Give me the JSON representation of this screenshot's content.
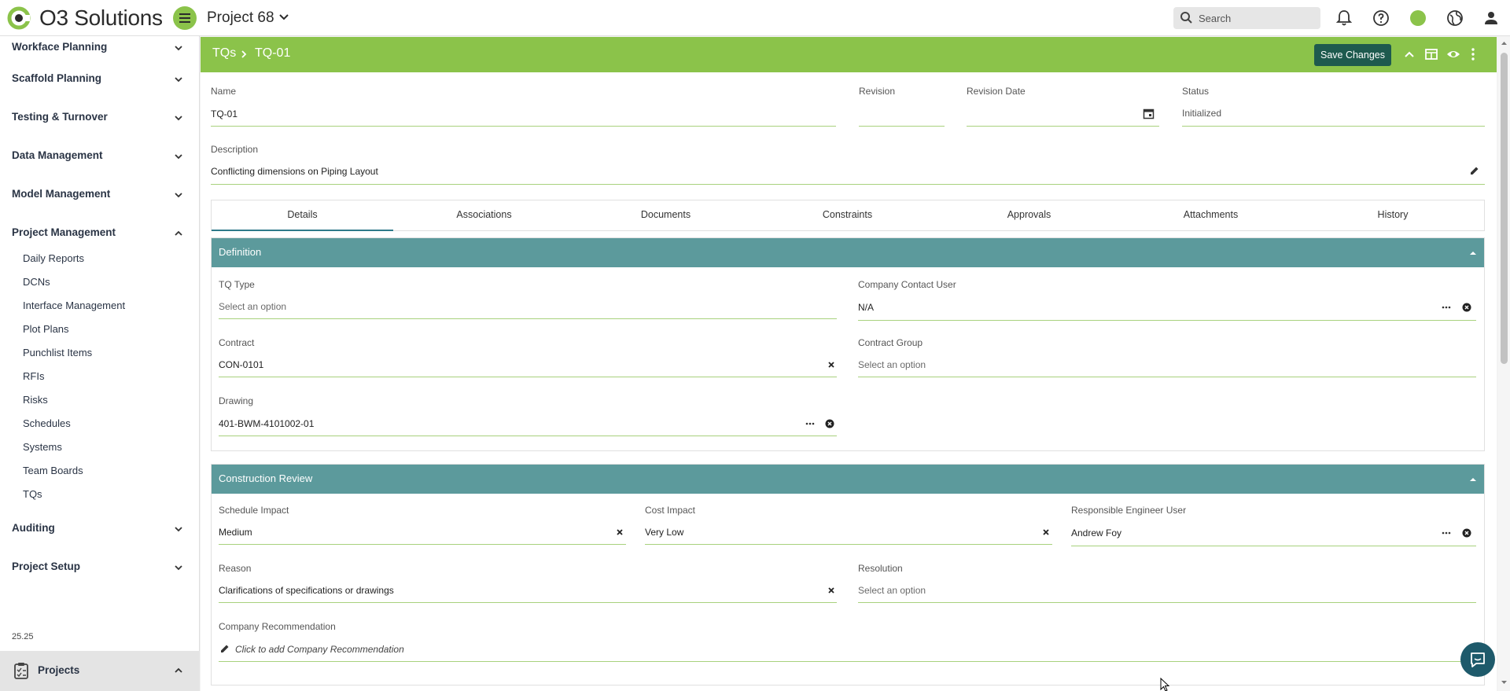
{
  "app": {
    "logo_text": "O3 Solutions",
    "project_title": "Project 68",
    "search_placeholder": "Search",
    "version": "25.25",
    "accent_color": "#8bc34a",
    "header_color": "#5c9a9c"
  },
  "sidebar": {
    "sections_top": [
      {
        "label": "Workface Planning",
        "expanded": false
      },
      {
        "label": "Scaffold Planning",
        "expanded": false
      },
      {
        "label": "Testing & Turnover",
        "expanded": false
      },
      {
        "label": "Data Management",
        "expanded": false
      },
      {
        "label": "Model Management",
        "expanded": false
      },
      {
        "label": "Project Management",
        "expanded": true
      }
    ],
    "project_management_items": [
      "Daily Reports",
      "DCNs",
      "Interface Management",
      "Plot Plans",
      "Punchlist Items",
      "RFIs",
      "Risks",
      "Schedules",
      "Systems",
      "Team Boards",
      "TQs"
    ],
    "sections_bottom": [
      {
        "label": "Auditing",
        "expanded": false
      },
      {
        "label": "Project Setup",
        "expanded": false
      }
    ],
    "projects_label": "Projects"
  },
  "header": {
    "breadcrumb_parent": "TQs",
    "breadcrumb_current": "TQ-01",
    "save_label": "Save Changes"
  },
  "form": {
    "name_label": "Name",
    "name_value": "TQ-01",
    "revision_label": "Revision",
    "revision_value": "",
    "revision_date_label": "Revision Date",
    "revision_date_value": "",
    "status_label": "Status",
    "status_value": "Initialized",
    "description_label": "Description",
    "description_value": "Conflicting dimensions on Piping Layout"
  },
  "tabs": [
    "Details",
    "Associations",
    "Documents",
    "Constraints",
    "Approvals",
    "Attachments",
    "History"
  ],
  "active_tab": "Details",
  "definition": {
    "title": "Definition",
    "tq_type_label": "TQ Type",
    "tq_type_placeholder": "Select an option",
    "company_contact_label": "Company Contact User",
    "company_contact_value": "N/A",
    "contract_label": "Contract",
    "contract_value": "CON-0101",
    "contract_group_label": "Contract Group",
    "contract_group_placeholder": "Select an option",
    "drawing_label": "Drawing",
    "drawing_value": "401-BWM-4101002-01"
  },
  "construction_review": {
    "title": "Construction Review",
    "schedule_impact_label": "Schedule Impact",
    "schedule_impact_value": "Medium",
    "cost_impact_label": "Cost Impact",
    "cost_impact_value": "Very Low",
    "responsible_engineer_label": "Responsible Engineer User",
    "responsible_engineer_value": "Andrew Foy",
    "reason_label": "Reason",
    "reason_value": "Clarifications of specifications or drawings",
    "resolution_label": "Resolution",
    "resolution_placeholder": "Select an option",
    "company_recommendation_label": "Company Recommendation",
    "company_recommendation_placeholder": "Click to add Company Recommendation"
  }
}
